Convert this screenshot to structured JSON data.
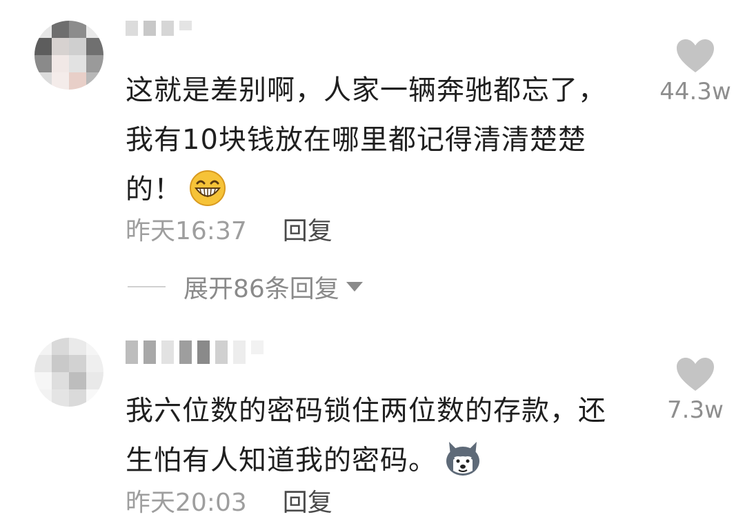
{
  "comments": [
    {
      "text": "这就是差别啊，人家一辆奔驰都忘了，我有10块钱放在哪里都记得清清楚楚的！",
      "emoji": "grin-emoji",
      "time": "昨天16:37",
      "reply_label": "回复",
      "likes": "44.3w",
      "expand_label": "展开86条回复"
    },
    {
      "text": "我六位数的密码锁住两位数的存款，还生怕有人知道我的密码。",
      "emoji": "husky-dog-emoji",
      "time": "昨天20:03",
      "reply_label": "回复",
      "likes": "7.3w"
    }
  ],
  "icons": {
    "like": "heart-icon",
    "expand": "triangle-down-icon"
  },
  "colors": {
    "text": "#1f1f1f",
    "meta": "#9e9e9e",
    "heart": "#c4c4c4",
    "emoji_yellow": "#f6c338"
  }
}
